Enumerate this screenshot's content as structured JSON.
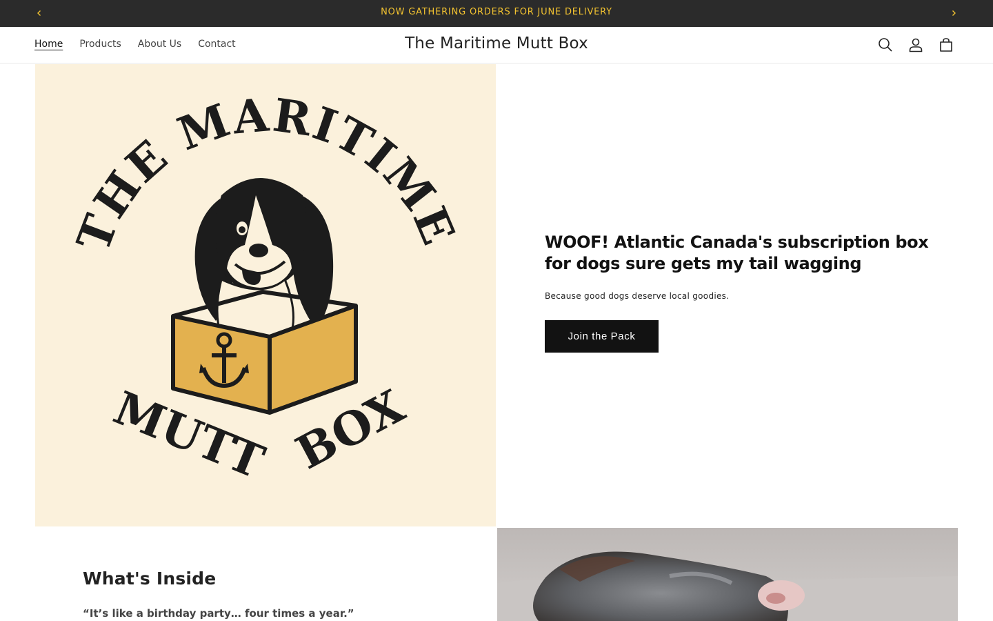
{
  "announcement": {
    "text": "NOW GATHERING ORDERS FOR JUNE DELIVERY",
    "prev_icon": "chevron-left-icon",
    "next_icon": "chevron-right-icon",
    "background": "#2b2b2b",
    "text_color": "#f2c230"
  },
  "header": {
    "nav": [
      {
        "label": "Home",
        "active": true
      },
      {
        "label": "Products"
      },
      {
        "label": "About Us"
      },
      {
        "label": "Contact"
      }
    ],
    "brand": "The Maritime Mutt Box",
    "icons": [
      "search-icon",
      "account-icon",
      "cart-icon"
    ]
  },
  "hero": {
    "logo": {
      "top_arc": "THE MARITIME",
      "bottom_left": "MUTT",
      "bottom_right": "BOX",
      "background": "#fbf1dc",
      "box_color": "#e3b14f"
    },
    "heading": "WOOF! Atlantic Canada's subscription box for dogs sure gets my tail wagging",
    "subheading": "Because good dogs deserve local goodies.",
    "button": "Join the Pack"
  },
  "inside": {
    "title": "What's Inside",
    "quote": "“It’s like a birthday party… four times a year.”"
  }
}
